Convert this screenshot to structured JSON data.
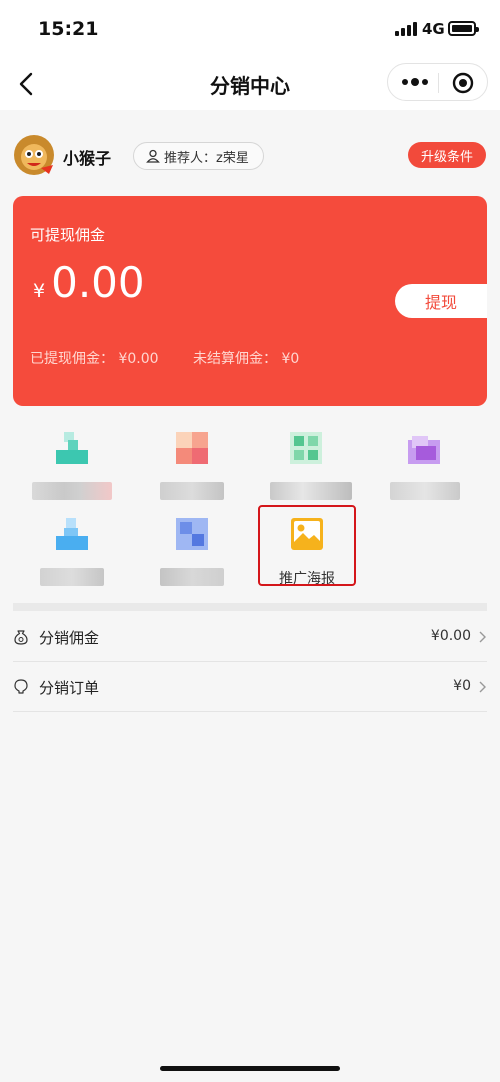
{
  "status_bar": {
    "time": "15:21",
    "network": "4G"
  },
  "nav": {
    "title": "分销中心"
  },
  "user": {
    "name": "小猴子",
    "referrer": "推荐人：z荣星",
    "upgrade_label": "升级条件"
  },
  "card": {
    "label": "可提现佣金",
    "currency": "¥",
    "amount": "0.00",
    "withdraw_label": "提现",
    "withdrawn": "已提现佣金：  ¥0.00",
    "unsettled": "未结算佣金：  ¥0"
  },
  "menu": {
    "items": [
      {
        "label": "",
        "icon": "pixelated-teal-icon",
        "color": "#3cc7b0"
      },
      {
        "label": "",
        "icon": "pixelated-coral-icon",
        "color": "#f48a7a"
      },
      {
        "label": "",
        "icon": "pixelated-green-icon",
        "color": "#54c690"
      },
      {
        "label": "",
        "icon": "pixelated-purple-icon",
        "color": "#b06fe0"
      },
      {
        "label": "",
        "icon": "pixelated-blue-icon",
        "color": "#4aaef0"
      },
      {
        "label": "",
        "icon": "pixelated-indigo-icon",
        "color": "#6d8ee8"
      },
      {
        "label": "推广海报",
        "icon": "image-poster-icon",
        "color": "#f6b21c"
      }
    ]
  },
  "list": {
    "items": [
      {
        "label": "分销佣金",
        "value": "¥0.00",
        "icon": "money-bag-icon"
      },
      {
        "label": "分销订单",
        "value": "¥0",
        "icon": "lightbulb-icon"
      }
    ]
  }
}
